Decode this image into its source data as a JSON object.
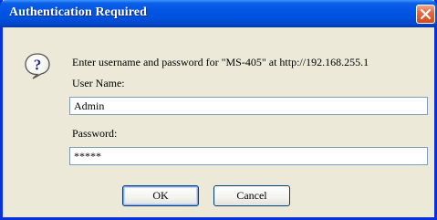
{
  "dialog": {
    "title": "Authentication Required",
    "prompt": "Enter username and password for \"MS-405\" at http://192.168.255.1",
    "username_label": "User Name:",
    "username_value": "Admin",
    "password_label": "Password:",
    "password_display": "*****",
    "ok_label": "OK",
    "cancel_label": "Cancel",
    "icon": "question-icon"
  },
  "colors": {
    "titlebar": "#0054e3",
    "window_bg": "#ece9d8",
    "close_button": "#e5693f",
    "field_border": "#7f9db9"
  }
}
